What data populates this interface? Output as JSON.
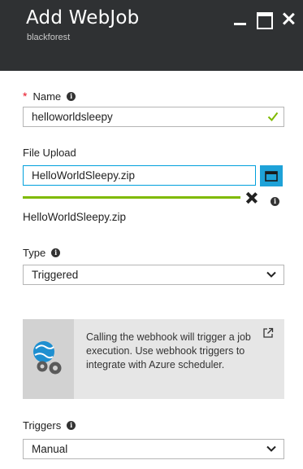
{
  "header": {
    "title": "Add WebJob",
    "subtitle": "blackforest"
  },
  "name_field": {
    "required_marker": "*",
    "label": "Name",
    "value": "helloworldsleepy",
    "valid": true
  },
  "file_upload": {
    "label": "File Upload",
    "value": "HelloWorldSleepy.zip",
    "progress_percent": 100,
    "uploaded_file_name": "HelloWorldSleepy.zip"
  },
  "type_field": {
    "label": "Type",
    "selected": "Triggered"
  },
  "info_box": {
    "text": "Calling the webhook will trigger a job execution. Use webhook triggers to integrate with Azure scheduler."
  },
  "triggers_field": {
    "label": "Triggers",
    "selected": "Manual"
  },
  "colors": {
    "header_bg": "#2f3133",
    "accent_blue": "#1ea2d8",
    "progress_green": "#7fba00",
    "required_red": "#e81123"
  }
}
